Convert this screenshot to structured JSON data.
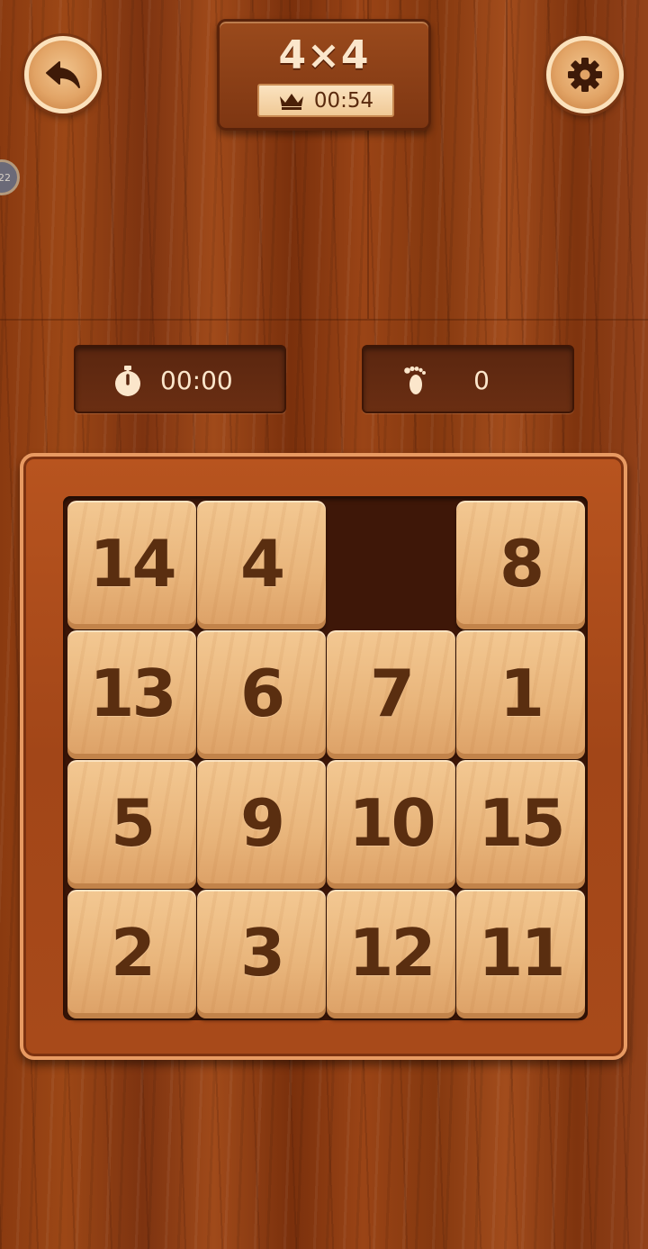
{
  "header": {
    "level_title": "4×4",
    "best_time": "00:54",
    "back_icon": "back-arrow-icon",
    "settings_icon": "gear-icon",
    "crown_icon": "crown-icon"
  },
  "side_badge": {
    "text": "22"
  },
  "stats": {
    "timer": {
      "icon": "stopwatch-icon",
      "value": "00:00"
    },
    "moves": {
      "icon": "footprint-icon",
      "value": "0"
    }
  },
  "board": {
    "size": 4,
    "tiles": [
      [
        "14",
        "4",
        "",
        "8"
      ],
      [
        "13",
        "6",
        "7",
        "1"
      ],
      [
        "5",
        "9",
        "10",
        "15"
      ],
      [
        "2",
        "3",
        "12",
        "11"
      ]
    ],
    "r0c0": "14",
    "r0c1": "4",
    "r0c3": "8",
    "r1c0": "13",
    "r1c1": "6",
    "r1c2": "7",
    "r1c3": "1",
    "r2c0": "5",
    "r2c1": "9",
    "r2c2": "10",
    "r2c3": "15",
    "r3c0": "2",
    "r3c1": "3",
    "r3c2": "12",
    "r3c3": "11"
  },
  "colors": {
    "tile_face": "#e8b47a",
    "tile_text": "#5a2e10",
    "frame": "#a84a1a",
    "panel_text": "#fbe6cb"
  }
}
